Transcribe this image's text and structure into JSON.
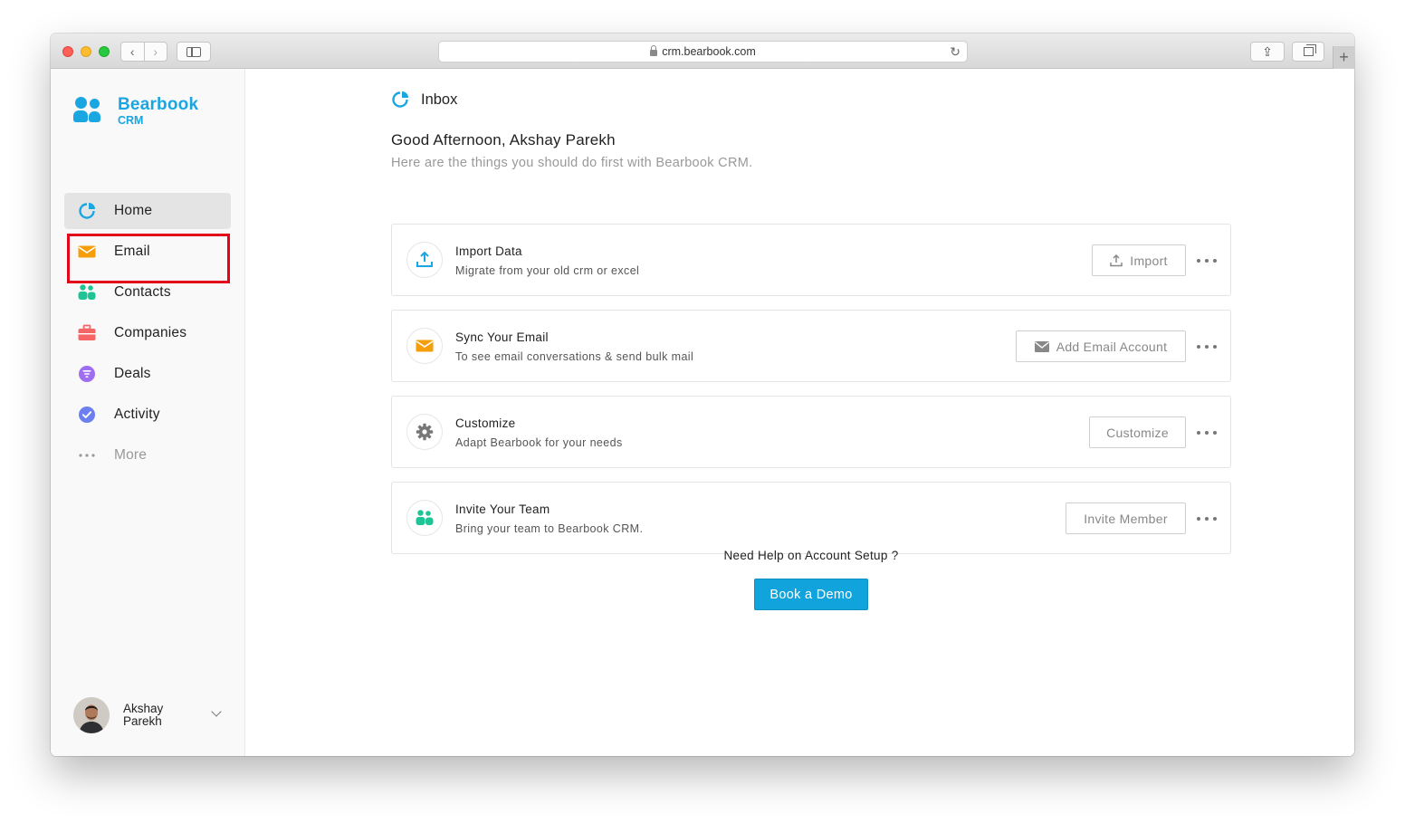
{
  "browser": {
    "url": "crm.bearbook.com",
    "nav_back": "‹",
    "nav_forward": "›",
    "share_glyph": "⇪",
    "reload_glyph": "↻",
    "newtab_glyph": "+"
  },
  "brand": {
    "name": "Bearbook",
    "sub": "CRM",
    "color": "#1aa6e0"
  },
  "sidebar": {
    "items": [
      {
        "label": "Home",
        "icon": "pie-chart-icon",
        "active": true
      },
      {
        "label": "Email",
        "icon": "envelope-icon"
      },
      {
        "label": "Contacts",
        "icon": "people-icon",
        "highlighted": true
      },
      {
        "label": "Companies",
        "icon": "briefcase-icon"
      },
      {
        "label": "Deals",
        "icon": "filter-circle-icon"
      },
      {
        "label": "Activity",
        "icon": "check-circle-icon"
      },
      {
        "label": "More",
        "icon": "dots-icon"
      }
    ],
    "user": {
      "name": "Akshay Parekh"
    }
  },
  "main": {
    "title": "Inbox",
    "greeting": "Good Afternoon, Akshay Parekh",
    "subtitle": "Here are the things you should do first with Bearbook CRM.",
    "cards": [
      {
        "title": "Import Data",
        "desc": "Migrate from your old crm or excel",
        "button": "Import",
        "icon": "upload-icon"
      },
      {
        "title": "Sync Your Email",
        "desc": "To see email conversations & send bulk mail",
        "button": "Add Email Account",
        "icon": "envelope-icon"
      },
      {
        "title": "Customize",
        "desc": "Adapt Bearbook for your needs",
        "button": "Customize",
        "icon": "gear-icon"
      },
      {
        "title": "Invite Your Team",
        "desc": "Bring your team to Bearbook CRM.",
        "button": "Invite Member",
        "icon": "people-icon"
      }
    ],
    "help_text": "Need Help on Account Setup ?",
    "demo_button": "Book a Demo"
  },
  "colors": {
    "accent": "#11a3dc",
    "email_orange": "#f59e0b",
    "contacts_green": "#1fc496",
    "companies_red": "#f56565",
    "deals_purple": "#9f6ef0",
    "activity_violet": "#6b7ff0",
    "highlight_red": "#e3061a"
  }
}
